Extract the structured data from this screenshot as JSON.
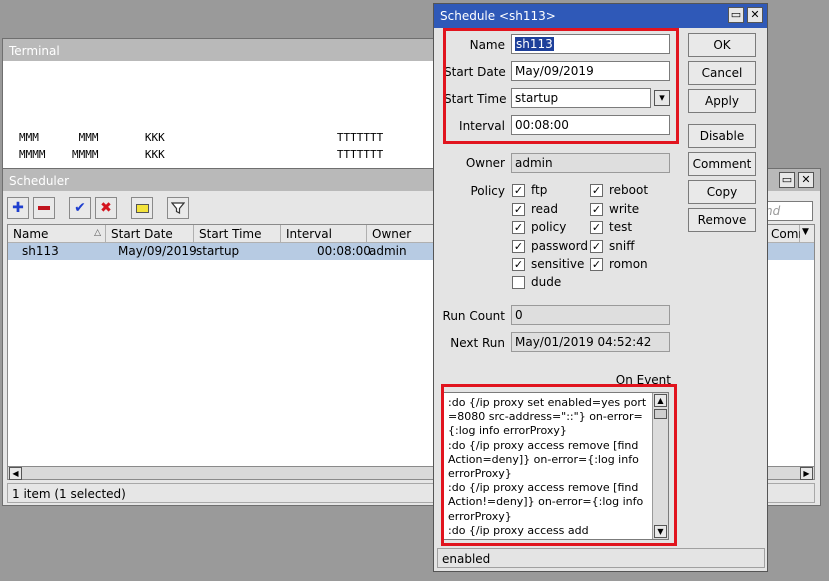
{
  "terminal": {
    "title": "Terminal",
    "lines": [
      "MMM      MMM       KKK                          TTTTTTT",
      "MMMM    MMMM       KKK                          TTTTTTT"
    ]
  },
  "scheduler": {
    "title": "Scheduler",
    "columns": [
      "Name",
      "Start Date",
      "Start Time",
      "Interval",
      "Owner",
      "Comm"
    ],
    "rows": [
      {
        "name": "sh113",
        "start_date": "May/09/2019",
        "start_time": "startup",
        "interval": "00:08:00",
        "owner": "admin"
      }
    ],
    "find_placeholder": "nd",
    "status": "1 item (1 selected)"
  },
  "dialog": {
    "title": "Schedule <sh113>",
    "fields": {
      "name_label": "Name",
      "name_value": "sh113",
      "start_date_label": "Start Date",
      "start_date_value": "May/09/2019",
      "start_time_label": "Start Time",
      "start_time_value": "startup",
      "interval_label": "Interval",
      "interval_value": "00:08:00",
      "owner_label": "Owner",
      "owner_value": "admin",
      "policy_label": "Policy",
      "run_count_label": "Run Count",
      "run_count_value": "0",
      "next_run_label": "Next Run",
      "next_run_value": "May/01/2019 04:52:42",
      "on_event_label": "On Event"
    },
    "policies": [
      {
        "label": "ftp",
        "checked": true
      },
      {
        "label": "reboot",
        "checked": true
      },
      {
        "label": "read",
        "checked": true
      },
      {
        "label": "write",
        "checked": true
      },
      {
        "label": "policy",
        "checked": true
      },
      {
        "label": "test",
        "checked": true
      },
      {
        "label": "password",
        "checked": true
      },
      {
        "label": "sniff",
        "checked": true
      },
      {
        "label": "sensitive",
        "checked": true
      },
      {
        "label": "romon",
        "checked": true
      },
      {
        "label": "dude",
        "checked": false
      }
    ],
    "on_event_text": ":do {/ip proxy set enabled=yes port=8080 src-address=\"::\"} on-error={:log info errorProxy}\n:do {/ip proxy access remove [find Action=deny]} on-error={:log info errorProxy}\n:do {/ip proxy access remove [find Action!=deny]} on-error={:log info errorProxy}\n:do {/ip proxy access add",
    "buttons": {
      "ok": "OK",
      "cancel": "Cancel",
      "apply": "Apply",
      "disable": "Disable",
      "comment": "Comment",
      "copy": "Copy",
      "remove": "Remove"
    },
    "status": "enabled"
  },
  "colors": {
    "titlebar_active": "#2f59b8",
    "highlight": "#e1141e",
    "selection": "#b7cbe3"
  }
}
